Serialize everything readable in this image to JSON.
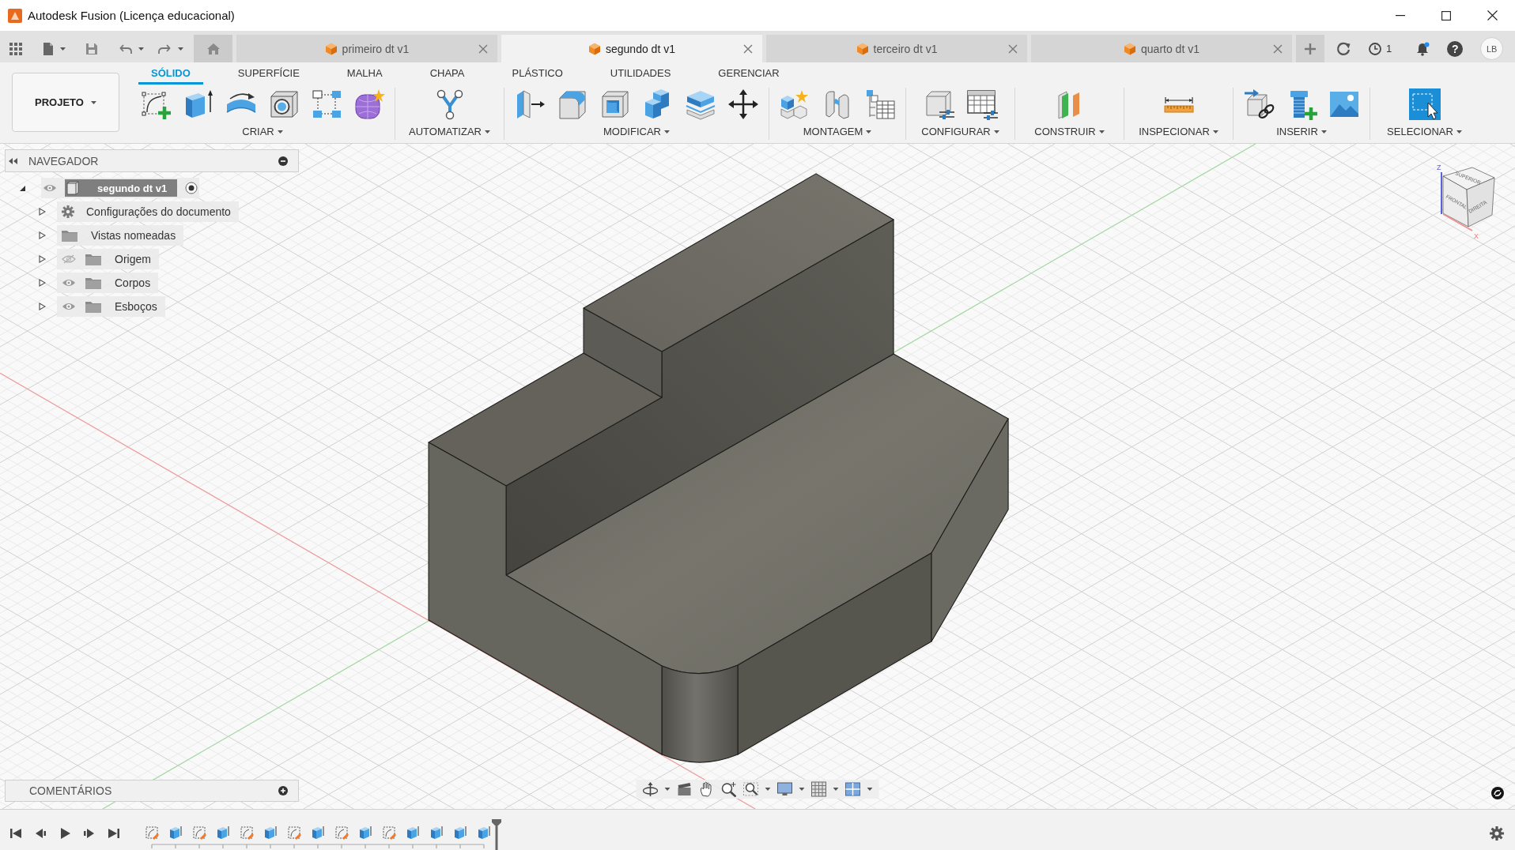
{
  "window": {
    "title": "Autodesk Fusion (Licença educacional)"
  },
  "document_tabs": [
    {
      "label": "primeiro dt v1",
      "selected": false
    },
    {
      "label": "segundo dt v1",
      "selected": true
    },
    {
      "label": "terceiro dt v1",
      "selected": false
    },
    {
      "label": "quarto dt v1",
      "selected": false
    }
  ],
  "header_status": {
    "jobs_count": "1",
    "notifications_unread": true,
    "help": "?",
    "user_initials": "LB"
  },
  "toolbar": {
    "project_button": "PROJETO",
    "tabs": [
      {
        "label": "SÓLIDO",
        "selected": true
      },
      {
        "label": "SUPERFÍCIE",
        "selected": false
      },
      {
        "label": "MALHA",
        "selected": false
      },
      {
        "label": "CHAPA",
        "selected": false
      },
      {
        "label": "PLÁSTICO",
        "selected": false
      },
      {
        "label": "UTILIDADES",
        "selected": false
      },
      {
        "label": "GERENCIAR",
        "selected": false
      }
    ],
    "groups": [
      {
        "label": "CRIAR"
      },
      {
        "label": "AUTOMATIZAR"
      },
      {
        "label": "MODIFICAR"
      },
      {
        "label": "MONTAGEM"
      },
      {
        "label": "CONFIGURAR"
      },
      {
        "label": "CONSTRUIR"
      },
      {
        "label": "INSPECIONAR"
      },
      {
        "label": "INSERIR"
      },
      {
        "label": "SELECIONAR"
      }
    ]
  },
  "navigator": {
    "title": "NAVEGADOR",
    "root": {
      "label": "segundo dt v1",
      "expanded": true,
      "visible": true,
      "active": true,
      "children": [
        {
          "kind": "settings",
          "label": "Configurações do documento",
          "expanded": false
        },
        {
          "kind": "folder",
          "label": "Vistas nomeadas",
          "expanded": false
        },
        {
          "kind": "layer",
          "label": "Origem",
          "expanded": false,
          "visible": false
        },
        {
          "kind": "layer",
          "label": "Corpos",
          "expanded": false,
          "visible": true
        },
        {
          "kind": "layer",
          "label": "Esboços",
          "expanded": false,
          "visible": true
        }
      ]
    }
  },
  "view_cube": {
    "faces": [
      "SUPERIOR",
      "FRONTAL",
      "DIREITA"
    ],
    "axes": [
      "Z",
      "X"
    ]
  },
  "comments": {
    "title": "COMENTÁRIOS"
  },
  "timeline": {
    "features": [
      {
        "kind": "sketch"
      },
      {
        "kind": "extrude"
      },
      {
        "kind": "sketch"
      },
      {
        "kind": "extrude"
      },
      {
        "kind": "sketch"
      },
      {
        "kind": "extrude"
      },
      {
        "kind": "sketch"
      },
      {
        "kind": "extrude"
      },
      {
        "kind": "sketch"
      },
      {
        "kind": "extrude"
      },
      {
        "kind": "sketch"
      },
      {
        "kind": "extrude"
      },
      {
        "kind": "extrude"
      },
      {
        "kind": "extrude"
      },
      {
        "kind": "extrude"
      }
    ]
  }
}
